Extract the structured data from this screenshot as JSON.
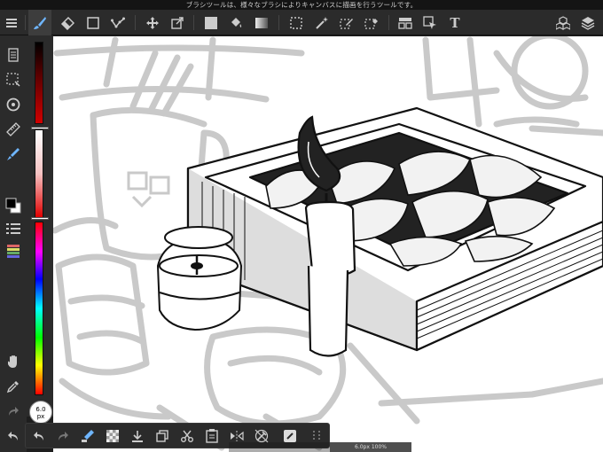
{
  "status_bar": {
    "text": "ブラシツールは、様々なブラシによりキャンバスに描画を行うツールです。"
  },
  "toolbar": {
    "menu_icon": "hamburger-icon",
    "tools": [
      "brush",
      "eraser",
      "rectangle-shape",
      "dot",
      "move",
      "transform",
      "fill-color",
      "bucket",
      "gradient",
      "select-rect",
      "magic-wand",
      "select-pen",
      "select-eraser",
      "panel-layout",
      "lasso-select",
      "text"
    ],
    "active_tool": "brush",
    "right": [
      "3d-materials",
      "layers"
    ],
    "text_tool_label": "T"
  },
  "sidebar": {
    "items": [
      "page-manager",
      "selection",
      "brush-settings",
      "ruler",
      "fill",
      "color-swatch",
      "layer-list",
      "palette",
      "hand",
      "eyedropper",
      "redo",
      "undo"
    ]
  },
  "color": {
    "primary": "#000000",
    "secondary": "#ffffff"
  },
  "brush_size": {
    "value": "6.0",
    "unit": "px"
  },
  "bottom_bar": {
    "items": [
      "undo",
      "redo",
      "pen-cursor",
      "transparent",
      "import",
      "copy",
      "cut",
      "paste",
      "flip",
      "no-snap",
      "snap",
      "grid"
    ]
  },
  "zoom": {
    "text": "6.0px 100%"
  }
}
